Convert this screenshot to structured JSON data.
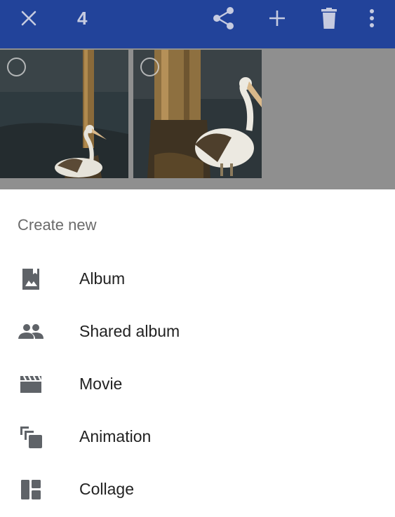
{
  "toolbar": {
    "close_icon": "close-icon",
    "selected_count": "4",
    "share_icon": "share-icon",
    "add_icon": "add-icon",
    "delete_icon": "delete-icon",
    "more_icon": "more-vert-icon",
    "background_color": "#22439a"
  },
  "photos": [
    {
      "subject": "pelican",
      "selected": false
    },
    {
      "subject": "pelican",
      "selected": false
    }
  ],
  "sheet": {
    "title": "Create new",
    "items": [
      {
        "label": "Album",
        "icon": "album-icon"
      },
      {
        "label": "Shared album",
        "icon": "shared-album-icon"
      },
      {
        "label": "Movie",
        "icon": "movie-icon"
      },
      {
        "label": "Animation",
        "icon": "animation-icon"
      },
      {
        "label": "Collage",
        "icon": "collage-icon"
      }
    ]
  }
}
